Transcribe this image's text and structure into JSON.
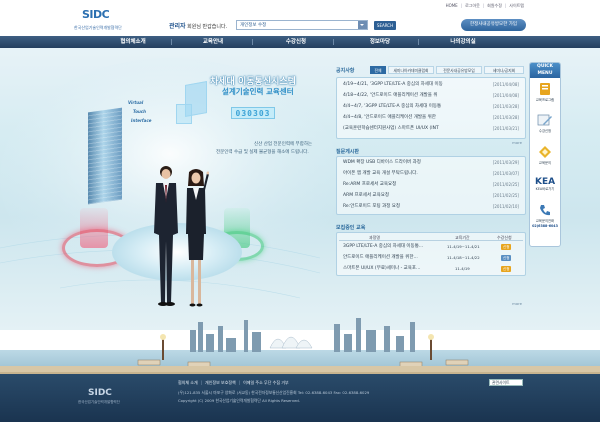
{
  "header": {
    "logo_text": "SIDC",
    "logo_sub": "한국산업기술인력개발협력단",
    "top_links": [
      "HOME",
      "로그아웃",
      "회원수정",
      "사이트맵"
    ],
    "welcome_name": "관리자",
    "welcome_suffix": " 회원님 반갑습니다.",
    "search_value": "개인정보 수정",
    "search_button": "SEARCH",
    "cta_button": "한정사내공유방모한 가입"
  },
  "nav": {
    "items": [
      "협의체소개",
      "교육안내",
      "수강신청",
      "정보마당",
      "나의강의실"
    ]
  },
  "hero": {
    "title1": "차세대 이동통신시스템",
    "title2": "설계기술인력 교육센터",
    "code": "030303",
    "sky_words": [
      "Virtual",
      "Touch",
      "Interface"
    ],
    "desc1": "신산 산업 전문인력에 부합하는",
    "desc2": "전문인력 수급 및 실제 불균형을 해소에 드립니다."
  },
  "board": {
    "title": "공지사항",
    "tabs": [
      "전체",
      "세미나아카데미클럽회",
      "전문사내공유방모임",
      "세미나/공지회"
    ],
    "notices": [
      {
        "title": "4/19~4/21, '3GPP LTE/LTE-A 중심의 차세대 이동",
        "date": "[2011/04/08]"
      },
      {
        "title": "4/18~4/22, '안드로이드 애플리케이션 개발을 위",
        "date": "[2011/04/08]"
      },
      {
        "title": "4/4~4/7, '3GPP LTE/LTE-A 중심의 차세대 이동통",
        "date": "[2011/03/28]"
      },
      {
        "title": "4/4~4/8, '안드로이드 애플리케이션 개발을 위한",
        "date": "[2011/03/28]"
      },
      {
        "title": "(교육훈련학습센터지원사업) 스마트폰 UI/UX (INT",
        "date": "[2011/03/21]"
      }
    ],
    "more": "more",
    "qna_title": "질문게시판",
    "qna": [
      {
        "title": "WDM 확장 USB 디바이스 드라이버 과정",
        "date": "[2011/03/29]"
      },
      {
        "title": "아이폰 앱 개발 교육 개설 부탁드립니다.",
        "date": "[2011/03/07]"
      },
      {
        "title": "Re:ARM 프로세서 교육요청",
        "date": "[2011/02/25]"
      },
      {
        "title": "ARM 프로세서 교육요청",
        "date": "[2011/02/25]"
      },
      {
        "title": "Re:안드로이드 포팅 과정 요청",
        "date": "[2011/02/10]"
      }
    ],
    "course_title": "모집중인 교육",
    "course_head": [
      "과정명",
      "교육기간",
      "수강신청"
    ],
    "courses": [
      {
        "name": "3GPP LTE/LTE-A 중심의 차세대 이동통...",
        "period": "11-4/19~11-4/21",
        "status": "신청"
      },
      {
        "name": "안드로이드 애플리케이션 개발을 위한...",
        "period": "11-4/18~11-4/22",
        "status": "신청"
      },
      {
        "name": "스마트폰 UI/UX (무료)세미나 - 교육포...",
        "period": "11-4/19",
        "status": "신청"
      }
    ]
  },
  "quick": {
    "title1": "QUICK",
    "title2": "MENU",
    "items": [
      "교육프로그램",
      "수강신청",
      "교육문의",
      "KEA바로가기",
      "교육문의전화"
    ],
    "phone": "02)6388-6043",
    "colors": {
      "accent": "#2d6aa3",
      "gold": "#e7a51e"
    }
  },
  "footer": {
    "links": [
      "협의체 소개",
      "개인정보 보호정책",
      "이메일 주소 무단 수집 거부"
    ],
    "select": "관련사이트",
    "address": "(우)121-835 서울시 마포구 양화로 (서교동) 한국전자정보통신산업진흥회 Tel: 02-6388-6043  Fax: 02-6388-6029",
    "copyright": "Copyright (C) 2009 한국산업기술인력개발협력단 All Rights Reserved.",
    "logo": "SIDC",
    "logo_sub": "한국산업기술인력개발협력단"
  }
}
